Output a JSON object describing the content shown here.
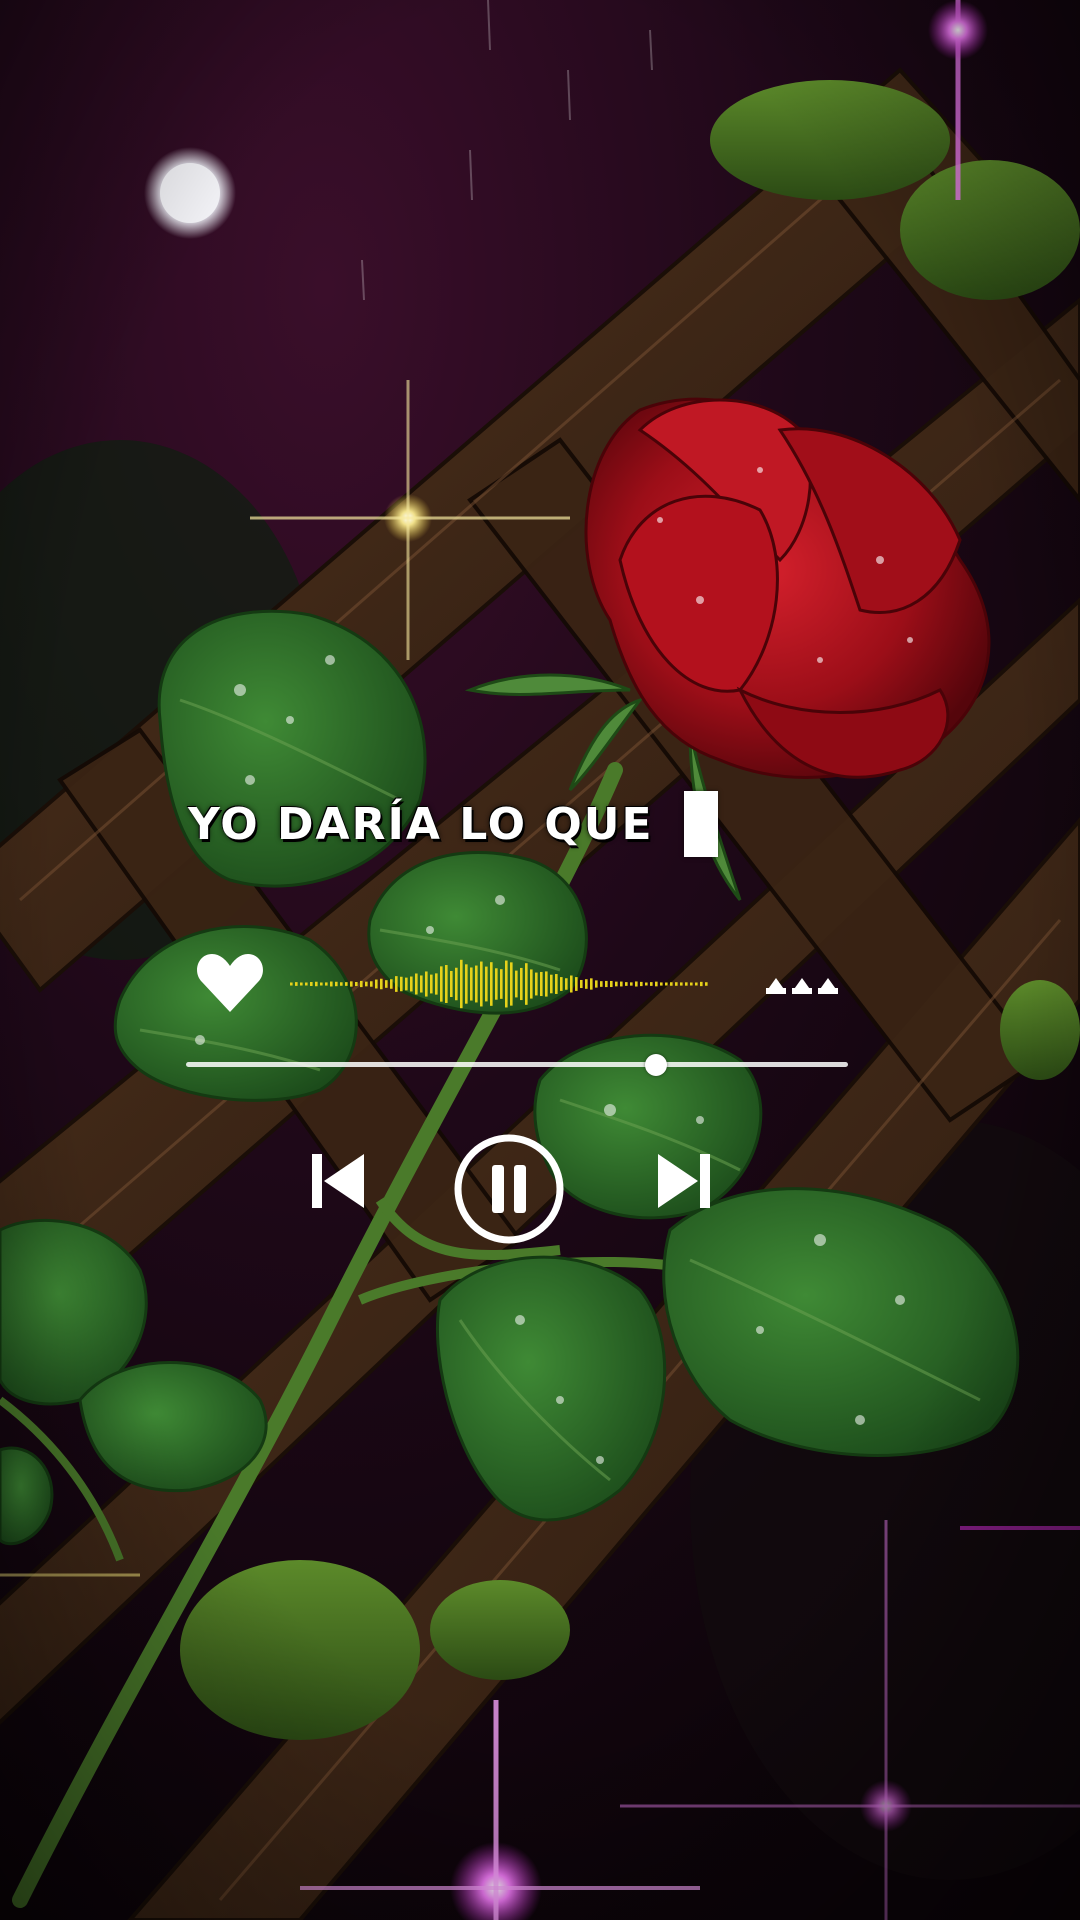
{
  "lyrics": {
    "current_line": "YO DARÍA LO QUE"
  },
  "player": {
    "liked": true,
    "progress": 0.71,
    "state": "playing",
    "icons": {
      "like": "heart-icon",
      "more": "more-options-icon",
      "previous": "skip-previous-icon",
      "pause": "pause-icon",
      "next": "skip-next-icon"
    }
  },
  "colors": {
    "waveform": "#e6d21a",
    "controls": "#ffffff",
    "rose": "#b3111d",
    "leaf": "#2e6b2a",
    "glow": "#d22dd6"
  }
}
